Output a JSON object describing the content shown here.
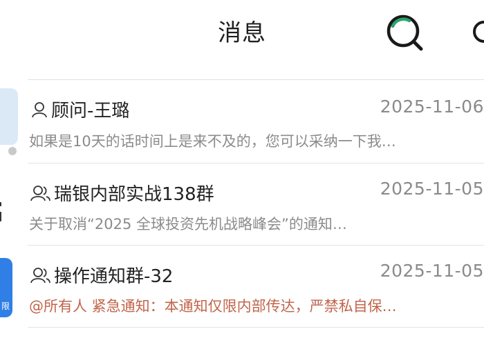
{
  "header": {
    "title": "消息",
    "search_icon": "search-icon",
    "more_icon": "more-icon"
  },
  "conversations": [
    {
      "type": "person",
      "icon": "person-icon",
      "name": "顾问-王璐",
      "time": "2025-11-06",
      "preview": "如果是10天的话时间上是来不及的，您可以采纳一下我…",
      "avatar_color": "#dbe9f7"
    },
    {
      "type": "group",
      "icon": "group-icon",
      "name": "瑞银内部实战138群",
      "time": "2025-11-05",
      "preview": "关于取消“2025 全球投资先机战略峰会”的通知…",
      "avatar_color": "#ffffff"
    },
    {
      "type": "group",
      "icon": "group-icon",
      "name": "操作通知群-32",
      "time": "2025-11-05",
      "preview_mention": "@所有人 紧急通知：本通知仅限内部传达，严禁私自保…",
      "avatar_color": "#2f7fe6",
      "avatar_text": "限"
    }
  ],
  "colors": {
    "accent_green": "#2aa56b",
    "mention": "#c0654b"
  }
}
